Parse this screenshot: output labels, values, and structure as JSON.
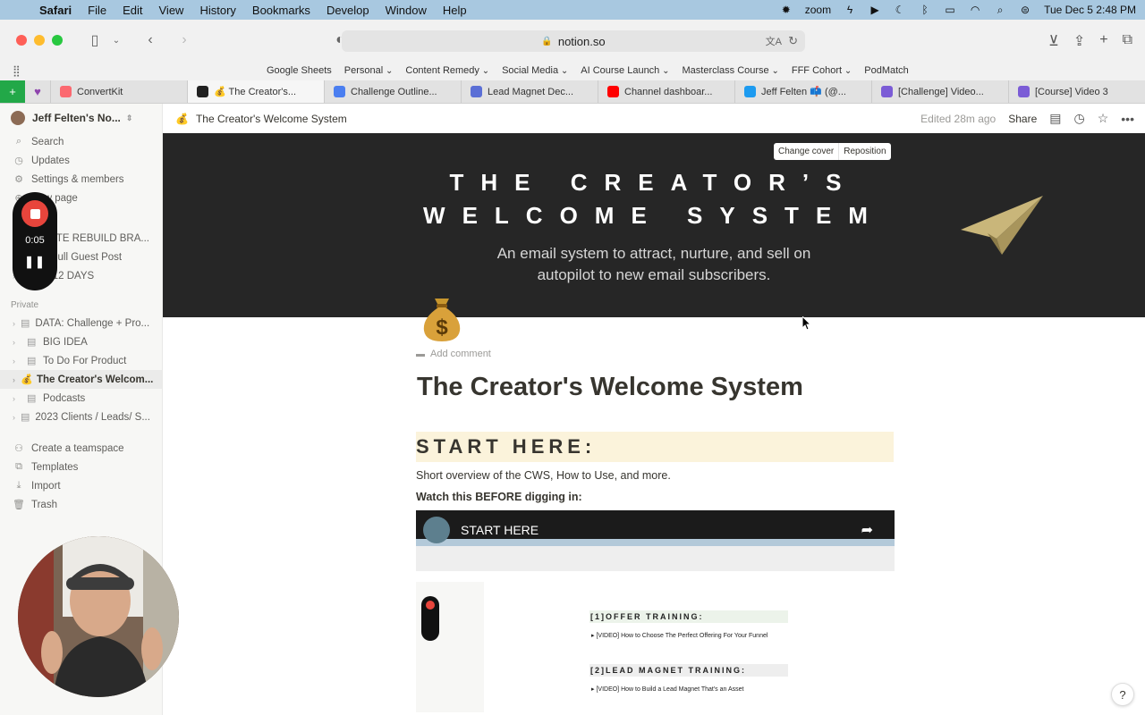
{
  "menubar": {
    "app": "Safari",
    "items": [
      "File",
      "Edit",
      "View",
      "History",
      "Bookmarks",
      "Develop",
      "Window",
      "Help"
    ],
    "zoom_label": "zoom",
    "clock": "Tue Dec 5  2:48 PM"
  },
  "browser": {
    "url": "notion.so",
    "favorites": [
      {
        "label": "Google Sheets",
        "menu": false
      },
      {
        "label": "Personal",
        "menu": true
      },
      {
        "label": "Content Remedy",
        "menu": true
      },
      {
        "label": "Social Media",
        "menu": true
      },
      {
        "label": "AI Course Launch",
        "menu": true
      },
      {
        "label": "Masterclass Course",
        "menu": true
      },
      {
        "label": "FFF Cohort",
        "menu": true
      },
      {
        "label": "PodMatch",
        "menu": false
      }
    ],
    "tabs": [
      {
        "label": "ConvertKit",
        "color": "#fb6970",
        "active": false
      },
      {
        "label": "💰 The Creator's...",
        "color": "#222222",
        "active": true
      },
      {
        "label": "Challenge Outline...",
        "color": "#4a7ef0",
        "active": false
      },
      {
        "label": "Lead Magnet Dec...",
        "color": "#5b6fd6",
        "active": false
      },
      {
        "label": "Channel dashboar...",
        "color": "#ff0000",
        "active": false
      },
      {
        "label": "Jeff Felten 📫 (@...",
        "color": "#1d9bf0",
        "active": false
      },
      {
        "label": "[Challenge] Video...",
        "color": "#7b5cd6",
        "active": false
      },
      {
        "label": "[Course] Video 3",
        "color": "#7b5cd6",
        "active": false
      }
    ]
  },
  "sidebar": {
    "workspace": "Jeff Felten's No...",
    "top_items": [
      {
        "label": "Search",
        "icon": "search-icon",
        "glyph": "⌕"
      },
      {
        "label": "Updates",
        "icon": "clock-icon",
        "glyph": "◷"
      },
      {
        "label": "Settings & members",
        "icon": "gear-icon",
        "glyph": "⚙"
      },
      {
        "label": "New page",
        "icon": "plus-icon",
        "glyph": "⊕"
      }
    ],
    "shared_items": [
      {
        "label": "WEBSITE REBUILD BRA..."
      },
      {
        "label": "Alex Llull Guest Post"
      },
      {
        "label": "OUR 12 DAYS"
      }
    ],
    "private_header": "Private",
    "private_items": [
      {
        "label": "DATA: Challenge + Pro...",
        "active": false
      },
      {
        "label": "BIG IDEA",
        "active": false
      },
      {
        "label": "To Do For Product",
        "active": false
      },
      {
        "label": "The Creator's Welcom...",
        "active": true
      },
      {
        "label": "Podcasts",
        "active": false
      },
      {
        "label": "2023 Clients / Leads/ S...",
        "active": false
      }
    ],
    "bottom_items": [
      {
        "label": "Create a teamspace",
        "icon": "teamspace-icon",
        "glyph": "⚇"
      },
      {
        "label": "Templates",
        "icon": "templates-icon",
        "glyph": "⧉"
      },
      {
        "label": "Import",
        "icon": "import-icon",
        "glyph": "⤓"
      },
      {
        "label": "Trash",
        "icon": "trash-icon",
        "glyph": "🗑"
      }
    ]
  },
  "recorder": {
    "time": "0:05"
  },
  "notion": {
    "breadcrumb": "The Creator's Welcome System",
    "breadcrumb_emoji": "💰",
    "edited": "Edited 28m ago",
    "share": "Share",
    "cover": {
      "change_cover": "Change cover",
      "reposition": "Reposition",
      "title_line1": "THE CREATOR’S",
      "title_line2": "WELCOME SYSTEM",
      "subtitle_line1": "An email system to attract, nurture, and sell on",
      "subtitle_line2": "autopilot to new email subscribers."
    },
    "add_comment": "Add comment",
    "page_title": "The Creator's Welcome System",
    "callout": "START HERE:",
    "overview": "Short overview of the CWS, How to Use, and more.",
    "watch": "Watch this BEFORE digging in:",
    "video": {
      "title": "START HERE",
      "share": "Share",
      "sections": [
        {
          "heading": "[1]OFFER TRAINING:",
          "link": "▸ [VIDEO] How to Choose The Perfect Offering For Your Funnel"
        },
        {
          "heading": "[2]LEAD MAGNET TRAINING:",
          "link": "▸ [VIDEO] How to Build a Lead Magnet That's an Asset"
        }
      ]
    },
    "help": "?"
  }
}
